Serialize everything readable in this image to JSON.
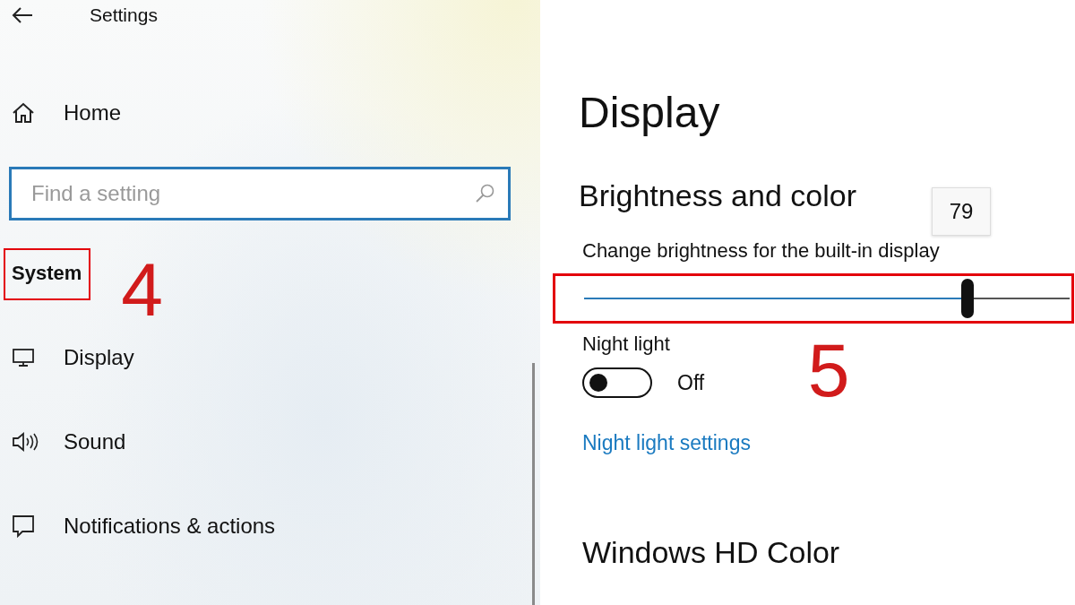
{
  "window": {
    "title": "Settings"
  },
  "nav": {
    "items": [
      {
        "label": "Home"
      }
    ],
    "search": {
      "placeholder": "Find a setting"
    },
    "section": {
      "title": "System",
      "annotated": true,
      "marker": "4"
    },
    "section_items": [
      {
        "label": "Display"
      },
      {
        "label": "Sound"
      },
      {
        "label": "Notifications & actions"
      }
    ]
  },
  "page": {
    "title": "Display",
    "group_title": "Brightness and color",
    "brightness": {
      "label": "Change brightness for the built-in display",
      "level": 0.79,
      "tooltip": "79",
      "annotated": true,
      "marker": "5"
    },
    "night_light": {
      "label": "Night light",
      "on": false,
      "state_text": "Off"
    },
    "link": "Night light settings",
    "next_group_title": "Windows HD Color"
  }
}
